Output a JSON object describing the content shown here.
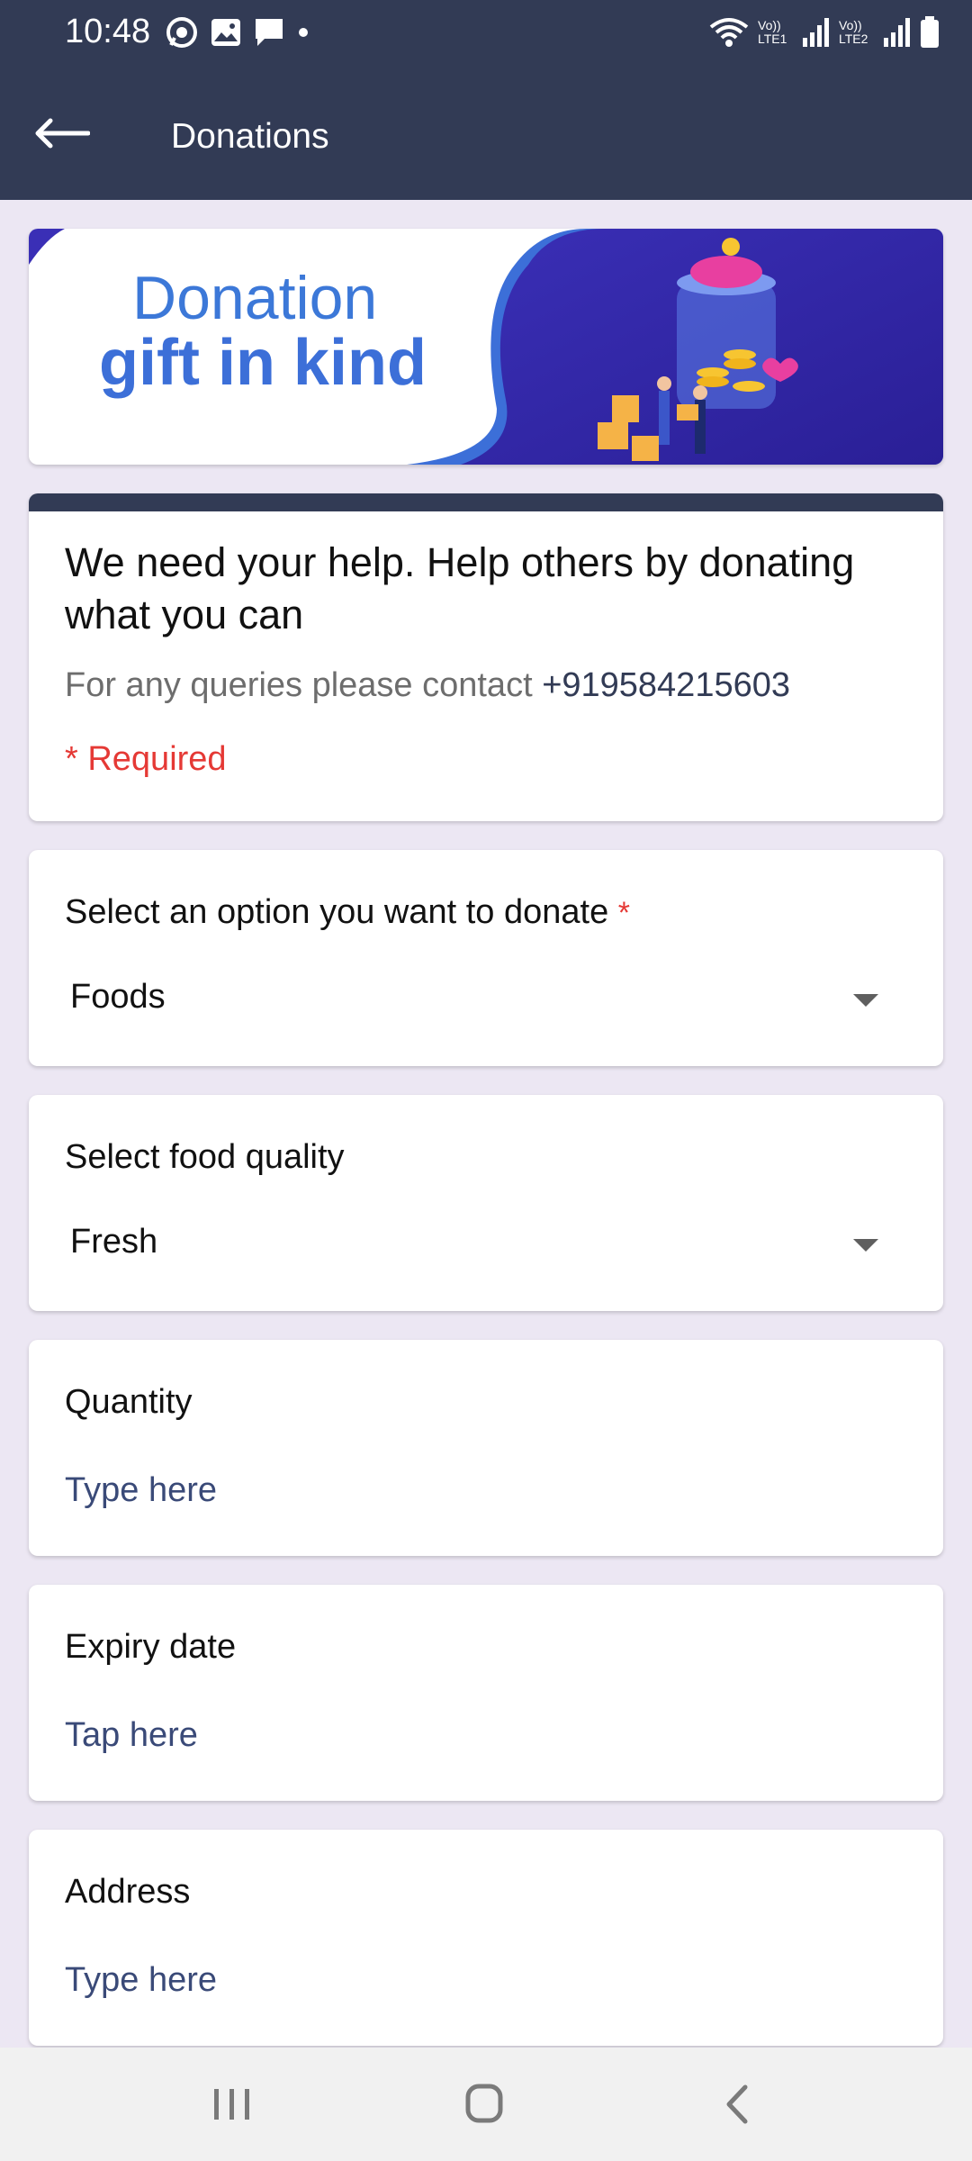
{
  "status": {
    "time": "10:48",
    "lte1": "Vo)) LTE1",
    "lte2": "Vo)) LTE2"
  },
  "appbar": {
    "title": "Donations"
  },
  "banner": {
    "line1": "Donation",
    "line2": "gift in kind"
  },
  "header": {
    "title": "We need your help. Help others by donating what you can",
    "contact_prefix": "For any queries please contact",
    "contact_phone": "+919584215603",
    "required": "* Required"
  },
  "fields": [
    {
      "label": "Select an option you want to donate",
      "required_mark": "*",
      "value": "Foods"
    },
    {
      "label": "Select food quality",
      "value": "Fresh"
    },
    {
      "label": "Quantity",
      "placeholder": "Type here"
    },
    {
      "label": "Expiry date",
      "placeholder": "Tap here"
    },
    {
      "label": "Address",
      "placeholder": "Type here"
    }
  ],
  "colors": {
    "primary": "#323b55",
    "required": "#e53935",
    "background": "#ece7f3",
    "banner_accent": "#3c6fd8"
  },
  "icons": [
    "whatsapp-icon",
    "gallery-icon",
    "message-icon",
    "wifi-icon",
    "signal-icon",
    "battery-icon",
    "back-arrow-icon",
    "recent-apps-icon",
    "home-icon",
    "nav-back-icon",
    "dropdown-caret-icon"
  ]
}
